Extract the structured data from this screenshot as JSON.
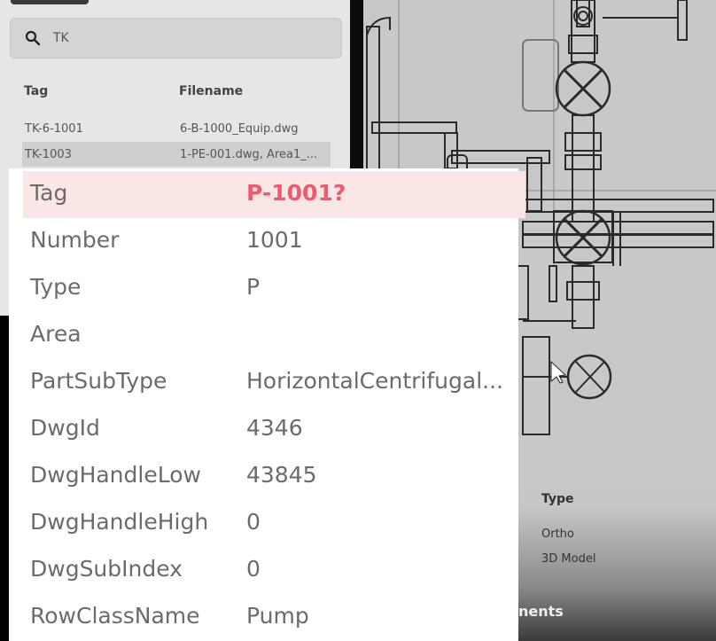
{
  "search": {
    "query": "TK",
    "columns": {
      "tag": "Tag",
      "filename": "Filename"
    },
    "results": [
      {
        "tag": "TK-6-1001",
        "filename": "6-B-1000_Equip.dwg"
      },
      {
        "tag": "TK-1003",
        "filename": "1-PE-001.dwg, Area1_..."
      }
    ]
  },
  "documents": {
    "type_header": "Type",
    "types": [
      "Ortho",
      "3D Model"
    ],
    "section_label": "nents"
  },
  "properties": [
    {
      "key": "Tag",
      "value": "P-1001?"
    },
    {
      "key": "Number",
      "value": "1001"
    },
    {
      "key": "Type",
      "value": "P"
    },
    {
      "key": "Area",
      "value": ""
    },
    {
      "key": "PartSubType",
      "value": "HorizontalCentrifugal..."
    },
    {
      "key": "DwgId",
      "value": "4346"
    },
    {
      "key": "DwgHandleLow",
      "value": "43845"
    },
    {
      "key": "DwgHandleHigh",
      "value": "0"
    },
    {
      "key": "DwgSubIndex",
      "value": "0"
    },
    {
      "key": "RowClassName",
      "value": "Pump"
    }
  ],
  "colors": {
    "highlight_bg": "#fbe6e6",
    "highlight_text": "#ef5a6e"
  },
  "icons": {
    "search": "search-icon",
    "valve": "valve-icon"
  }
}
